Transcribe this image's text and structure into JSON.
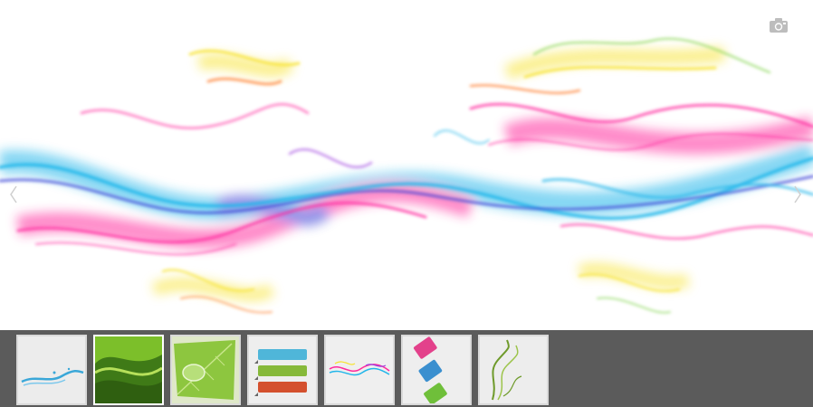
{
  "viewer": {
    "main_image": "colorful-smoke-waves",
    "icons": {
      "camera": "camera-icon",
      "prev": "chevron-left-icon",
      "next": "chevron-right-icon"
    }
  },
  "thumbnails": [
    {
      "id": "thumb-1",
      "subject": "water-splash-wave",
      "selected": false
    },
    {
      "id": "thumb-2",
      "subject": "green-abstract-waves",
      "selected": true
    },
    {
      "id": "thumb-3",
      "subject": "green-leaf-droplet",
      "selected": false
    },
    {
      "id": "thumb-4",
      "subject": "ribbon-banners",
      "selected": false
    },
    {
      "id": "thumb-5",
      "subject": "colorful-smoke",
      "selected": false
    },
    {
      "id": "thumb-6",
      "subject": "tag-labels",
      "selected": false
    },
    {
      "id": "thumb-7",
      "subject": "green-smoke",
      "selected": false
    }
  ],
  "colors": {
    "strip_bg": "#5b5b5b",
    "thumb_border": "#d9d9d9",
    "thumb_border_selected": "#ffffff",
    "smoke": [
      "#ff2a9d",
      "#22b6ea",
      "#3a3fd6",
      "#f7e22a",
      "#ff7a2a",
      "#9c3ee0",
      "#7fd24a"
    ]
  }
}
